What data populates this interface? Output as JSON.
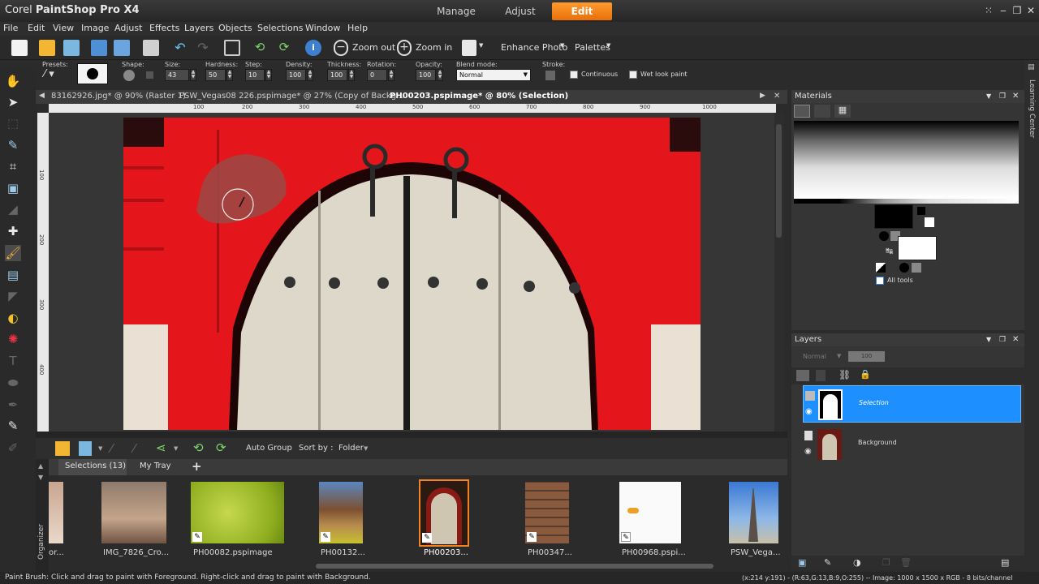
{
  "title": {
    "prefix": "Corel",
    "name": "PaintShop Pro X4",
    "modes": [
      {
        "label": "Manage",
        "active": false
      },
      {
        "label": "Adjust",
        "active": false
      },
      {
        "label": "Edit",
        "active": true
      }
    ],
    "window_buttons": [
      "⁙",
      "‒",
      "❐",
      "✕"
    ]
  },
  "menu": [
    "File",
    "Edit",
    "View",
    "Image",
    "Adjust",
    "Effects",
    "Layers",
    "Objects",
    "Selections",
    "Window",
    "Help"
  ],
  "toolbar": {
    "zoom_out": "Zoom out",
    "zoom_in": "Zoom in",
    "enhance_photo": "Enhance Photo",
    "palettes": "Palettes"
  },
  "tool_options": {
    "presets_label": "Presets:",
    "shape_label": "Shape:",
    "size_label": "Size:",
    "size_value": "43",
    "hardness_label": "Hardness:",
    "hardness_value": "50",
    "step_label": "Step:",
    "step_value": "10",
    "density_label": "Density:",
    "density_value": "100",
    "thickness_label": "Thickness:",
    "thickness_value": "100",
    "rotation_label": "Rotation:",
    "rotation_value": "0",
    "opacity_label": "Opacity:",
    "opacity_value": "100",
    "blend_label": "Blend mode:",
    "blend_value": "Normal",
    "stroke_label": "Stroke:",
    "continuous": "Continuous",
    "wet_look": "Wet look paint"
  },
  "doc_tabs": [
    {
      "label": "83162926.jpg* @  90% (Raster 1)",
      "active": false
    },
    {
      "label": "PSW_Vegas08 226.pspimage* @  27% (Copy of Backg...",
      "active": false
    },
    {
      "label": "PH00203.pspimage* @  80% (Selection)",
      "active": true
    }
  ],
  "rulers": {
    "h": [
      "100",
      "200",
      "300",
      "400",
      "500",
      "600",
      "700",
      "800",
      "900",
      "1000"
    ],
    "v": [
      "100",
      "200",
      "300",
      "400"
    ]
  },
  "organizer": {
    "auto_group": "Auto Group",
    "sort_by": "Sort by :",
    "folder": "Folder",
    "tabs": [
      "Selections (13)",
      "My Tray"
    ],
    "add": "+",
    "side_label": "Organizer",
    "thumbs": [
      {
        "caption": "or..."
      },
      {
        "caption": "IMG_7826_Cro..."
      },
      {
        "caption": "PH00082.pspimage"
      },
      {
        "caption": "PH00132..."
      },
      {
        "caption": "PH00203..."
      },
      {
        "caption": "PH00347..."
      },
      {
        "caption": "PH00968.pspi..."
      },
      {
        "caption": "PSW_Vega..."
      }
    ]
  },
  "materials": {
    "title": "Materials",
    "all_tools": "All tools"
  },
  "layers": {
    "title": "Layers",
    "blend": "Normal",
    "opacity": "100",
    "items": [
      {
        "name": "Selection",
        "selected": true
      },
      {
        "name": "Background",
        "selected": false
      }
    ]
  },
  "learning_center": "Learning Center",
  "status": {
    "left": "Paint Brush: Click and drag to paint with Foreground. Right-click and drag to paint with Background.",
    "right": "(x:214 y:191) - (R:63,G:13,B:9,O:255) -- Image:  1000 x 1500 x RGB - 8 bits/channel"
  },
  "colors": {
    "accent": "#f58220",
    "door_red": "#e4161b",
    "layer_selected": "#1e90ff"
  }
}
